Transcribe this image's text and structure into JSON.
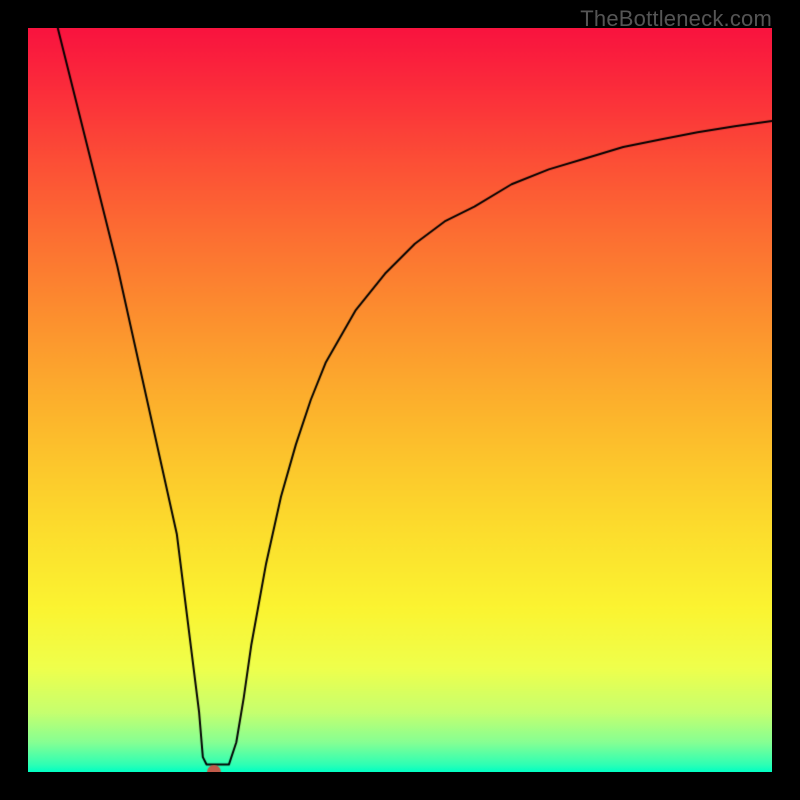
{
  "watermark": "TheBottleneck.com",
  "chart_data": {
    "type": "line",
    "title": "",
    "xlabel": "",
    "ylabel": "",
    "xlim": [
      0,
      100
    ],
    "ylim": [
      0,
      100
    ],
    "grid": false,
    "legend": false,
    "marker": {
      "x": 25,
      "y": 0,
      "color": "#c15b4a",
      "radius": 7
    },
    "curve": [
      {
        "x": 4,
        "y": 100
      },
      {
        "x": 6,
        "y": 92
      },
      {
        "x": 8,
        "y": 84
      },
      {
        "x": 10,
        "y": 76
      },
      {
        "x": 12,
        "y": 68
      },
      {
        "x": 14,
        "y": 59
      },
      {
        "x": 16,
        "y": 50
      },
      {
        "x": 18,
        "y": 41
      },
      {
        "x": 20,
        "y": 32
      },
      {
        "x": 21,
        "y": 24
      },
      {
        "x": 22,
        "y": 16
      },
      {
        "x": 23,
        "y": 8
      },
      {
        "x": 23.5,
        "y": 2
      },
      {
        "x": 24,
        "y": 1
      },
      {
        "x": 25,
        "y": 1
      },
      {
        "x": 26,
        "y": 1
      },
      {
        "x": 27,
        "y": 1
      },
      {
        "x": 28,
        "y": 4
      },
      {
        "x": 29,
        "y": 10
      },
      {
        "x": 30,
        "y": 17
      },
      {
        "x": 32,
        "y": 28
      },
      {
        "x": 34,
        "y": 37
      },
      {
        "x": 36,
        "y": 44
      },
      {
        "x": 38,
        "y": 50
      },
      {
        "x": 40,
        "y": 55
      },
      {
        "x": 44,
        "y": 62
      },
      {
        "x": 48,
        "y": 67
      },
      {
        "x": 52,
        "y": 71
      },
      {
        "x": 56,
        "y": 74
      },
      {
        "x": 60,
        "y": 76
      },
      {
        "x": 65,
        "y": 79
      },
      {
        "x": 70,
        "y": 81
      },
      {
        "x": 75,
        "y": 82.5
      },
      {
        "x": 80,
        "y": 84
      },
      {
        "x": 85,
        "y": 85
      },
      {
        "x": 90,
        "y": 86
      },
      {
        "x": 95,
        "y": 86.8
      },
      {
        "x": 100,
        "y": 87.5
      }
    ],
    "gradient_stops": [
      {
        "offset": 0.0,
        "color": "#f9133f"
      },
      {
        "offset": 0.08,
        "color": "#fb2c3b"
      },
      {
        "offset": 0.18,
        "color": "#fc4f36"
      },
      {
        "offset": 0.28,
        "color": "#fc6f32"
      },
      {
        "offset": 0.38,
        "color": "#fc8d2f"
      },
      {
        "offset": 0.48,
        "color": "#fcaa2d"
      },
      {
        "offset": 0.58,
        "color": "#fcc52c"
      },
      {
        "offset": 0.68,
        "color": "#fcde2d"
      },
      {
        "offset": 0.78,
        "color": "#fbf431"
      },
      {
        "offset": 0.86,
        "color": "#efff4c"
      },
      {
        "offset": 0.92,
        "color": "#c6ff6f"
      },
      {
        "offset": 0.96,
        "color": "#86ff93"
      },
      {
        "offset": 0.99,
        "color": "#2effb4"
      },
      {
        "offset": 1.0,
        "color": "#00ffc3"
      }
    ]
  }
}
